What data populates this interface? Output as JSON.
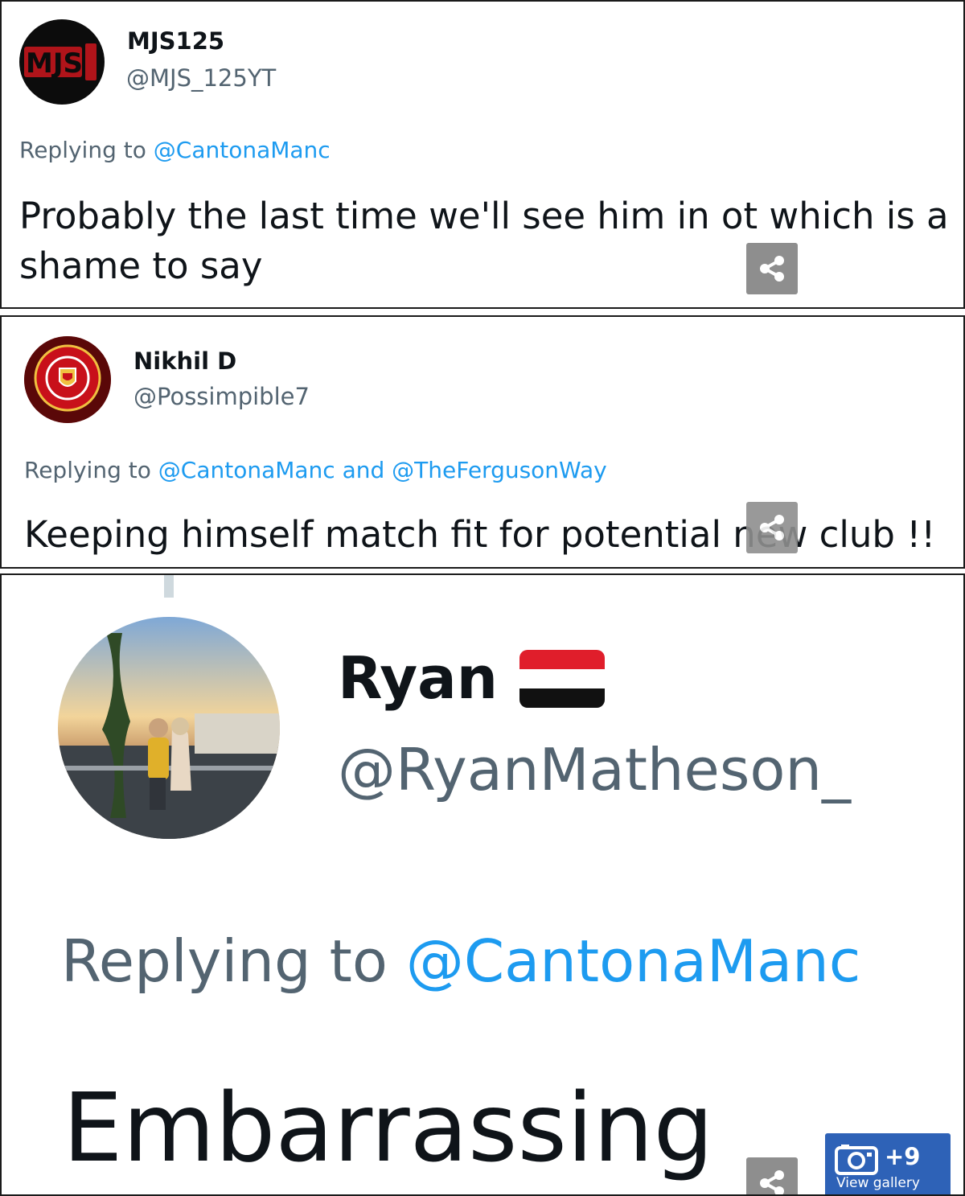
{
  "replies": [
    {
      "name": "MJS125",
      "handle": "@MJS_125YT",
      "replying_prefix": "Replying to",
      "replying_to": "@CantonaManc",
      "text": "Probably the last time we'll see him in ot which is a shame to say",
      "avatar_icon": "mjs-logo-avatar",
      "avatar_text": "MJS"
    },
    {
      "name": "Nikhil D",
      "handle": "@Possimpible7",
      "replying_prefix": "Replying to",
      "replying_to": "@CantonaManc and @TheFergusonWay",
      "text": "Keeping himself match fit for potential new club !!",
      "avatar_icon": "manchester-united-crest-avatar"
    },
    {
      "name": "Ryan",
      "handle": "@RyanMatheson_",
      "replying_prefix": "Replying to",
      "replying_to": "@CantonaManc",
      "text": "Embarrassing",
      "avatar_icon": "couple-photo-avatar",
      "flag_icon": "red-white-black-flag"
    }
  ],
  "gallery_badge": {
    "icon": "camera-icon",
    "count": "+9",
    "label": "View gallery"
  },
  "share_icon": "share-icon",
  "colors": {
    "link": "#1d9bf0",
    "secondary_text": "#536471",
    "badge_blue": "#2e62b7",
    "share_gray": "#8e8e8e"
  }
}
